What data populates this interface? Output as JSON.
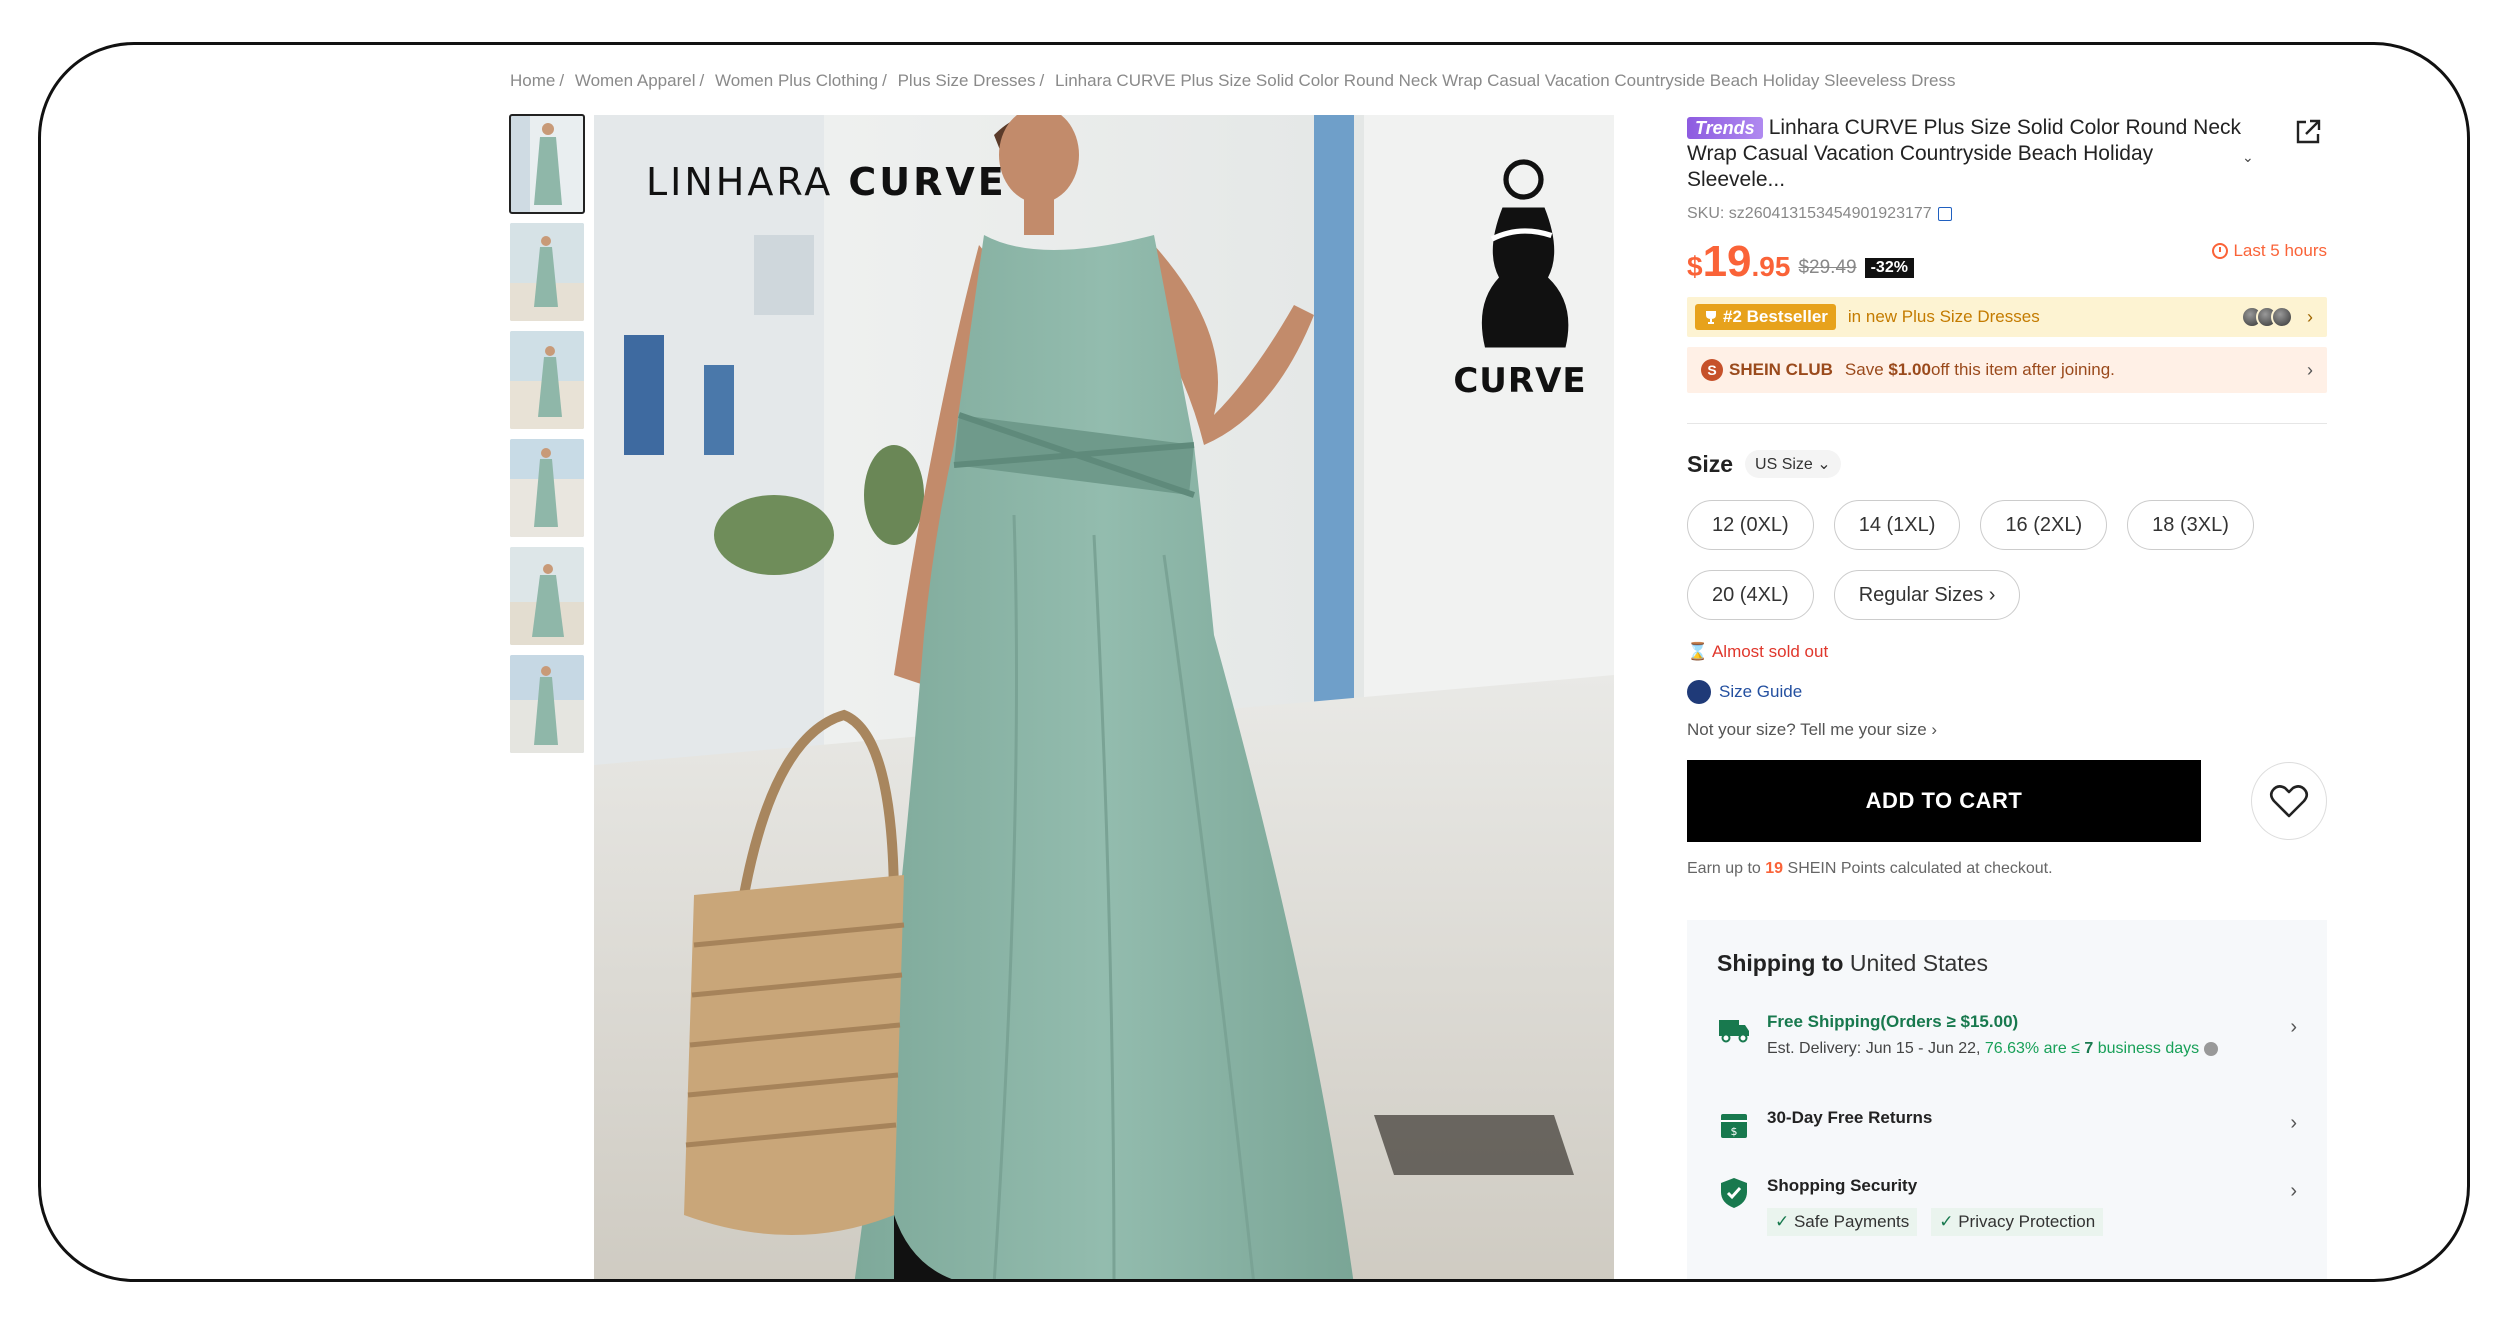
{
  "breadcrumb": [
    "Home",
    "Women Apparel",
    "Women Plus Clothing",
    "Plus Size Dresses",
    "Linhara CURVE Plus Size Solid Color Round Neck Wrap Casual Vacation Countryside Beach Holiday Sleeveless Dress"
  ],
  "breadcrumb_sep": "/",
  "image": {
    "brand_light": "LINHARA",
    "brand_bold": "CURVE",
    "logo_word": "CURVE"
  },
  "product": {
    "trends_tag": "Trends",
    "title_line1": "Linhara CURVE Plus Size Solid Color Round Neck",
    "title_line2": "Wrap Casual Vacation Countryside Beach Holiday Sleevele...",
    "sku": "SKU: sz2604131534549019231​77"
  },
  "price": {
    "currency": "$",
    "whole": "19",
    "cents": ".95",
    "old": "$29.49",
    "discount": "-32%",
    "timer": "Last 5 hours"
  },
  "bestseller": {
    "tag": "#2 Bestseller",
    "text": "in new Plus Size Dresses"
  },
  "club": {
    "name": "SHEIN CLUB",
    "text_pre": "Save ",
    "amount": "$1.00",
    "text_post": " off this item after joining."
  },
  "size": {
    "label": "Size",
    "unit": "US Size",
    "options": [
      "12 (0XL)",
      "14 (1XL)",
      "16 (2XL)",
      "18 (3XL)",
      "20 (4XL)",
      "Regular Sizes ›"
    ],
    "almost": "Almost sold out",
    "guide": "Size Guide",
    "not_your_size": "Not your size? Tell me your size ›"
  },
  "cart": {
    "add_label": "ADD TO CART",
    "earn_pre": "Earn up to ",
    "points": "19",
    "earn_post": " SHEIN Points calculated at checkout."
  },
  "shipping": {
    "title_bold": "Shipping to",
    "country": "United States",
    "free": "Free Shipping(Orders ≥ $15.00)",
    "est_pre": "Est. Delivery: Jun 15 - Jun 22, ",
    "est_pct": "76.63% are ≤ ",
    "est_days": "7",
    "est_post": " business days",
    "returns": "30-Day Free Returns",
    "security": "Shopping Security",
    "checks": [
      "Safe Payments",
      "Privacy Protection"
    ]
  },
  "colors": {
    "accent": "#fa6338",
    "dress": "#8fb7a9",
    "green": "#18794e"
  }
}
